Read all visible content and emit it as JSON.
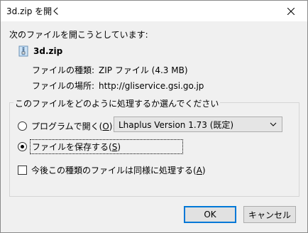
{
  "window": {
    "title": "3d.zip を開く",
    "close_icon": "close-icon"
  },
  "intro": "次のファイルを開こうとしています:",
  "file": {
    "name": "3d.zip",
    "icon": "zip-file-icon",
    "type_label": "ファイルの種類:",
    "type_value": "ZIP ファイル (4.3 MB)",
    "location_label": "ファイルの場所:",
    "location_value": "http://gliservice.gsi.go.jp"
  },
  "group": {
    "legend": "このファイルをどのように処理するか選んでください",
    "open_with": {
      "label": "プログラムで開く(",
      "key": "O",
      "suffix": "):",
      "checked": false,
      "selected_program": "Lhaplus Version 1.73 (既定)"
    },
    "save_file": {
      "label": "ファイルを保存する(",
      "key": "S",
      "suffix": ")",
      "checked": true
    },
    "remember": {
      "label": "今後この種類のファイルは同様に処理する(",
      "key": "A",
      "suffix": ")",
      "checked": false
    }
  },
  "buttons": {
    "ok": "OK",
    "cancel": "キャンセル"
  }
}
